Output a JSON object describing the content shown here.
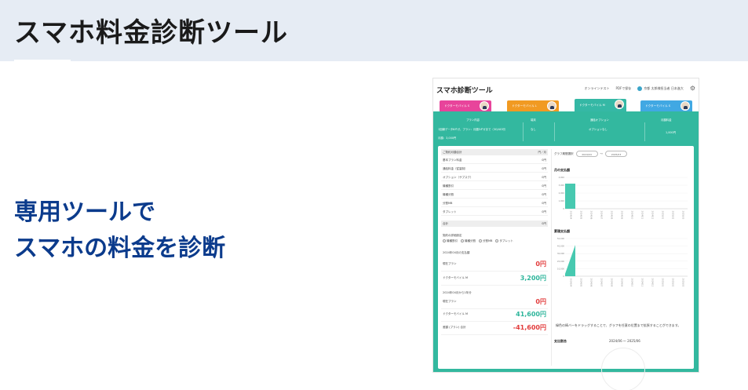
{
  "header": {
    "title": "スマホ料金診断ツール"
  },
  "tagline": {
    "line1": "専用ツールで",
    "line2": "スマホの料金を診断"
  },
  "app": {
    "title": "スマホ診断ツール",
    "nav": {
      "online_test": "オンラインテスト",
      "pdf_output": "PDFで保存",
      "user_name": "京都 太郎様担当者 日本進大"
    },
    "plan_tabs": [
      {
        "label": "ドクターモバイル S",
        "color": "#e8449b"
      },
      {
        "label": "ドクターモバイル L",
        "color": "#f19a22"
      },
      {
        "label": "ドクターモバイル M",
        "color": "#35b8a5"
      },
      {
        "label": "ドクターモバイル S",
        "color": "#41a8e3"
      }
    ],
    "summary": {
      "headers": [
        "プラン内容",
        "端末",
        "通話オプション",
        "月額料金"
      ],
      "row1": [
        "1回線データ6ギガ、プラン：月額3ギガまで（3G/4G可）",
        "なし",
        "オプションなし",
        "1,000円"
      ],
      "row2": "月額：3,000円"
    },
    "left": {
      "section1_title": "ご契約月額合計",
      "section1_right": "円／月",
      "items": [
        {
          "label": "基本プラン料金",
          "value": "0円"
        },
        {
          "label": "通話料金（従量制）",
          "value": "0円"
        },
        {
          "label": "オプション（サブスク）",
          "value": "0円"
        },
        {
          "label": "機種割引",
          "value": "0円"
        },
        {
          "label": "機種分割",
          "value": "0円"
        },
        {
          "label": "分割MB",
          "value": "0円"
        },
        {
          "label": "タブレット",
          "value": "0円"
        }
      ],
      "section2_title": "合計",
      "section2_right": "0円",
      "checks_title": "契約の詳細設定",
      "checks": [
        "機種割引",
        "機種分割",
        "分割MB",
        "タブレット"
      ],
      "period1": "2024年04月の支払額",
      "current_plan_label1": "現在プラン",
      "current_plan_value1": "0円",
      "new_plan_label1": "ドクターモバイル M",
      "new_plan_value1": "3,200円",
      "period2": "2024年04月から1年分",
      "current_plan_label2": "現在プラン",
      "current_plan_value2": "0円",
      "new_plan_label2": "ドクターモバイル M",
      "new_plan_value2": "41,600円",
      "diff_label": "差額 (プラン) 合計",
      "diff_value": "-41,600円"
    },
    "right": {
      "range_label": "グラフ期間選択",
      "range_from": "2024/04",
      "range_sep": "〜",
      "range_to": "2025/03",
      "monthly_title": "月の支払額",
      "cumulative_title": "累積支払額",
      "note": "緑色の棒バーをドラッグすることで、グラフを任意の位置まで拡張することができます。",
      "expense_title": "支出割合",
      "expense_range": "2024/06 〜 2025/06"
    },
    "chart_data": [
      {
        "type": "bar",
        "title": "月の支払額",
        "categories": [
          "2024/04",
          "2024/05",
          "2024/06",
          "2024/07",
          "2024/08",
          "2024/09",
          "2024/10",
          "2024/11",
          "2024/12",
          "2025/01",
          "2025/02",
          "2025/03"
        ],
        "values": [
          3200,
          0,
          0,
          0,
          0,
          0,
          0,
          0,
          0,
          0,
          0,
          0
        ],
        "yticks": [
          "0",
          "1,000",
          "2,000",
          "3,000",
          "4,000"
        ],
        "ylim": [
          0,
          4000
        ],
        "color": "#47c9b0"
      },
      {
        "type": "area",
        "title": "累積支払額",
        "categories": [
          "2024/04",
          "2024/05",
          "2024/06",
          "2024/07",
          "2024/08",
          "2024/09",
          "2024/10",
          "2024/11",
          "2024/12",
          "2025/01",
          "2025/02",
          "2025/03"
        ],
        "values": [
          3200,
          41600,
          null,
          null,
          null,
          null,
          null,
          null,
          null,
          null,
          null,
          null
        ],
        "yticks": [
          "0",
          "10,000",
          "20,000",
          "30,000",
          "40,000",
          "50,000"
        ],
        "ylim": [
          0,
          50000
        ],
        "color": "#47c9b0"
      }
    ]
  }
}
